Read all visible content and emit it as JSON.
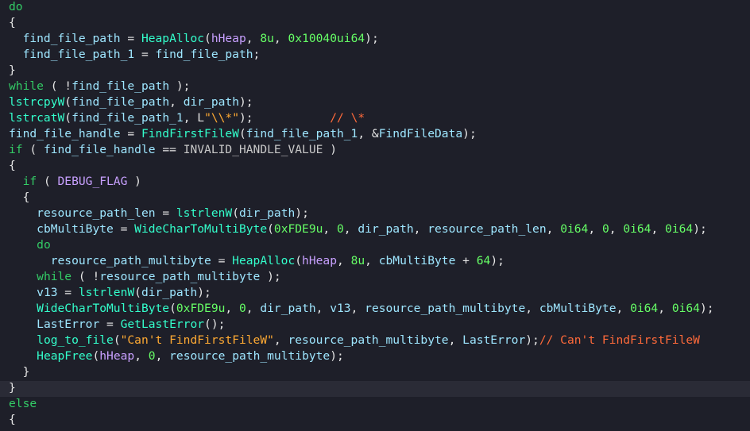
{
  "editor": {
    "highlighted_line": 24,
    "lines": [
      {
        "tokens": [
          {
            "t": "do",
            "c": "kw"
          }
        ]
      },
      {
        "tokens": [
          {
            "t": "{",
            "c": "sym"
          }
        ]
      },
      {
        "tokens": [
          {
            "t": "  ",
            "c": "sym"
          },
          {
            "t": "find_file_path",
            "c": "id"
          },
          {
            "t": " = ",
            "c": "sym"
          },
          {
            "t": "HeapAlloc",
            "c": "fn"
          },
          {
            "t": "(",
            "c": "sym"
          },
          {
            "t": "hHeap",
            "c": "glob"
          },
          {
            "t": ", ",
            "c": "sym"
          },
          {
            "t": "8u",
            "c": "num"
          },
          {
            "t": ", ",
            "c": "sym"
          },
          {
            "t": "0x10040ui64",
            "c": "num"
          },
          {
            "t": ");",
            "c": "sym"
          }
        ]
      },
      {
        "tokens": [
          {
            "t": "  ",
            "c": "sym"
          },
          {
            "t": "find_file_path_1",
            "c": "id"
          },
          {
            "t": " = ",
            "c": "sym"
          },
          {
            "t": "find_file_path",
            "c": "id"
          },
          {
            "t": ";",
            "c": "sym"
          }
        ]
      },
      {
        "tokens": [
          {
            "t": "}",
            "c": "sym"
          }
        ]
      },
      {
        "tokens": [
          {
            "t": "while",
            "c": "kw"
          },
          {
            "t": " ( !",
            "c": "sym"
          },
          {
            "t": "find_file_path",
            "c": "id"
          },
          {
            "t": " );",
            "c": "sym"
          }
        ]
      },
      {
        "tokens": [
          {
            "t": "lstrcpyW",
            "c": "fn"
          },
          {
            "t": "(",
            "c": "sym"
          },
          {
            "t": "find_file_path",
            "c": "id"
          },
          {
            "t": ", ",
            "c": "sym"
          },
          {
            "t": "dir_path",
            "c": "id"
          },
          {
            "t": ");",
            "c": "sym"
          }
        ]
      },
      {
        "tokens": [
          {
            "t": "lstrcatW",
            "c": "fn"
          },
          {
            "t": "(",
            "c": "sym"
          },
          {
            "t": "find_file_path_1",
            "c": "id"
          },
          {
            "t": ", ",
            "c": "sym"
          },
          {
            "t": "L",
            "c": "sym"
          },
          {
            "t": "\"\\\\*\"",
            "c": "str"
          },
          {
            "t": ");           ",
            "c": "sym"
          },
          {
            "t": "// \\*",
            "c": "cmt"
          }
        ]
      },
      {
        "tokens": [
          {
            "t": "find_file_handle",
            "c": "id"
          },
          {
            "t": " = ",
            "c": "sym"
          },
          {
            "t": "FindFirstFileW",
            "c": "fn"
          },
          {
            "t": "(",
            "c": "sym"
          },
          {
            "t": "find_file_path_1",
            "c": "id"
          },
          {
            "t": ", &",
            "c": "sym"
          },
          {
            "t": "FindFileData",
            "c": "id"
          },
          {
            "t": ");",
            "c": "sym"
          }
        ]
      },
      {
        "tokens": [
          {
            "t": "if",
            "c": "kw"
          },
          {
            "t": " ( ",
            "c": "sym"
          },
          {
            "t": "find_file_handle",
            "c": "id"
          },
          {
            "t": " == ",
            "c": "sym"
          },
          {
            "t": "INVALID_HANDLE_VALUE",
            "c": "const"
          },
          {
            "t": " )",
            "c": "sym"
          }
        ]
      },
      {
        "tokens": [
          {
            "t": "{",
            "c": "sym"
          }
        ]
      },
      {
        "tokens": [
          {
            "t": "  ",
            "c": "sym"
          },
          {
            "t": "if",
            "c": "kw"
          },
          {
            "t": " ( ",
            "c": "sym"
          },
          {
            "t": "DEBUG_FLAG",
            "c": "glob"
          },
          {
            "t": " )",
            "c": "sym"
          }
        ]
      },
      {
        "tokens": [
          {
            "t": "  {",
            "c": "sym"
          }
        ]
      },
      {
        "tokens": [
          {
            "t": "    ",
            "c": "sym"
          },
          {
            "t": "resource_path_len",
            "c": "id"
          },
          {
            "t": " = ",
            "c": "sym"
          },
          {
            "t": "lstrlenW",
            "c": "fn"
          },
          {
            "t": "(",
            "c": "sym"
          },
          {
            "t": "dir_path",
            "c": "id"
          },
          {
            "t": ");",
            "c": "sym"
          }
        ]
      },
      {
        "tokens": [
          {
            "t": "    ",
            "c": "sym"
          },
          {
            "t": "cbMultiByte",
            "c": "id"
          },
          {
            "t": " = ",
            "c": "sym"
          },
          {
            "t": "WideCharToMultiByte",
            "c": "fn"
          },
          {
            "t": "(",
            "c": "sym"
          },
          {
            "t": "0xFDE9u",
            "c": "num"
          },
          {
            "t": ", ",
            "c": "sym"
          },
          {
            "t": "0",
            "c": "num"
          },
          {
            "t": ", ",
            "c": "sym"
          },
          {
            "t": "dir_path",
            "c": "id"
          },
          {
            "t": ", ",
            "c": "sym"
          },
          {
            "t": "resource_path_len",
            "c": "id"
          },
          {
            "t": ", ",
            "c": "sym"
          },
          {
            "t": "0i64",
            "c": "num"
          },
          {
            "t": ", ",
            "c": "sym"
          },
          {
            "t": "0",
            "c": "num"
          },
          {
            "t": ", ",
            "c": "sym"
          },
          {
            "t": "0i64",
            "c": "num"
          },
          {
            "t": ", ",
            "c": "sym"
          },
          {
            "t": "0i64",
            "c": "num"
          },
          {
            "t": ");",
            "c": "sym"
          }
        ]
      },
      {
        "tokens": [
          {
            "t": "    ",
            "c": "sym"
          },
          {
            "t": "do",
            "c": "kw"
          }
        ]
      },
      {
        "tokens": [
          {
            "t": "      ",
            "c": "sym"
          },
          {
            "t": "resource_path_multibyte",
            "c": "id"
          },
          {
            "t": " = ",
            "c": "sym"
          },
          {
            "t": "HeapAlloc",
            "c": "fn"
          },
          {
            "t": "(",
            "c": "sym"
          },
          {
            "t": "hHeap",
            "c": "glob"
          },
          {
            "t": ", ",
            "c": "sym"
          },
          {
            "t": "8u",
            "c": "num"
          },
          {
            "t": ", ",
            "c": "sym"
          },
          {
            "t": "cbMultiByte",
            "c": "id"
          },
          {
            "t": " + ",
            "c": "sym"
          },
          {
            "t": "64",
            "c": "num"
          },
          {
            "t": ");",
            "c": "sym"
          }
        ]
      },
      {
        "tokens": [
          {
            "t": "    ",
            "c": "sym"
          },
          {
            "t": "while",
            "c": "kw"
          },
          {
            "t": " ( !",
            "c": "sym"
          },
          {
            "t": "resource_path_multibyte",
            "c": "id"
          },
          {
            "t": " );",
            "c": "sym"
          }
        ]
      },
      {
        "tokens": [
          {
            "t": "    ",
            "c": "sym"
          },
          {
            "t": "v13",
            "c": "id"
          },
          {
            "t": " = ",
            "c": "sym"
          },
          {
            "t": "lstrlenW",
            "c": "fn"
          },
          {
            "t": "(",
            "c": "sym"
          },
          {
            "t": "dir_path",
            "c": "id"
          },
          {
            "t": ");",
            "c": "sym"
          }
        ]
      },
      {
        "tokens": [
          {
            "t": "    ",
            "c": "sym"
          },
          {
            "t": "WideCharToMultiByte",
            "c": "fn"
          },
          {
            "t": "(",
            "c": "sym"
          },
          {
            "t": "0xFDE9u",
            "c": "num"
          },
          {
            "t": ", ",
            "c": "sym"
          },
          {
            "t": "0",
            "c": "num"
          },
          {
            "t": ", ",
            "c": "sym"
          },
          {
            "t": "dir_path",
            "c": "id"
          },
          {
            "t": ", ",
            "c": "sym"
          },
          {
            "t": "v13",
            "c": "id"
          },
          {
            "t": ", ",
            "c": "sym"
          },
          {
            "t": "resource_path_multibyte",
            "c": "id"
          },
          {
            "t": ", ",
            "c": "sym"
          },
          {
            "t": "cbMultiByte",
            "c": "id"
          },
          {
            "t": ", ",
            "c": "sym"
          },
          {
            "t": "0i64",
            "c": "num"
          },
          {
            "t": ", ",
            "c": "sym"
          },
          {
            "t": "0i64",
            "c": "num"
          },
          {
            "t": ");",
            "c": "sym"
          }
        ]
      },
      {
        "tokens": [
          {
            "t": "    ",
            "c": "sym"
          },
          {
            "t": "LastError",
            "c": "id"
          },
          {
            "t": " = ",
            "c": "sym"
          },
          {
            "t": "GetLastError",
            "c": "fn"
          },
          {
            "t": "();",
            "c": "sym"
          }
        ]
      },
      {
        "tokens": [
          {
            "t": "    ",
            "c": "sym"
          },
          {
            "t": "log_to_file",
            "c": "fn"
          },
          {
            "t": "(",
            "c": "sym"
          },
          {
            "t": "\"Can't FindFirstFileW\"",
            "c": "str"
          },
          {
            "t": ", ",
            "c": "sym"
          },
          {
            "t": "resource_path_multibyte",
            "c": "id"
          },
          {
            "t": ", ",
            "c": "sym"
          },
          {
            "t": "LastError",
            "c": "id"
          },
          {
            "t": ");",
            "c": "sym"
          },
          {
            "t": "// Can't FindFirstFileW",
            "c": "cmt"
          }
        ]
      },
      {
        "tokens": [
          {
            "t": "    ",
            "c": "sym"
          },
          {
            "t": "HeapFree",
            "c": "fn"
          },
          {
            "t": "(",
            "c": "sym"
          },
          {
            "t": "hHeap",
            "c": "glob"
          },
          {
            "t": ", ",
            "c": "sym"
          },
          {
            "t": "0",
            "c": "num"
          },
          {
            "t": ", ",
            "c": "sym"
          },
          {
            "t": "resource_path_multibyte",
            "c": "id"
          },
          {
            "t": ");",
            "c": "sym"
          }
        ]
      },
      {
        "tokens": [
          {
            "t": "  }",
            "c": "sym"
          }
        ]
      },
      {
        "tokens": [
          {
            "t": "}",
            "c": "sym"
          }
        ]
      },
      {
        "tokens": [
          {
            "t": "else",
            "c": "kw"
          }
        ]
      },
      {
        "tokens": [
          {
            "t": "{",
            "c": "sym"
          }
        ]
      }
    ]
  }
}
